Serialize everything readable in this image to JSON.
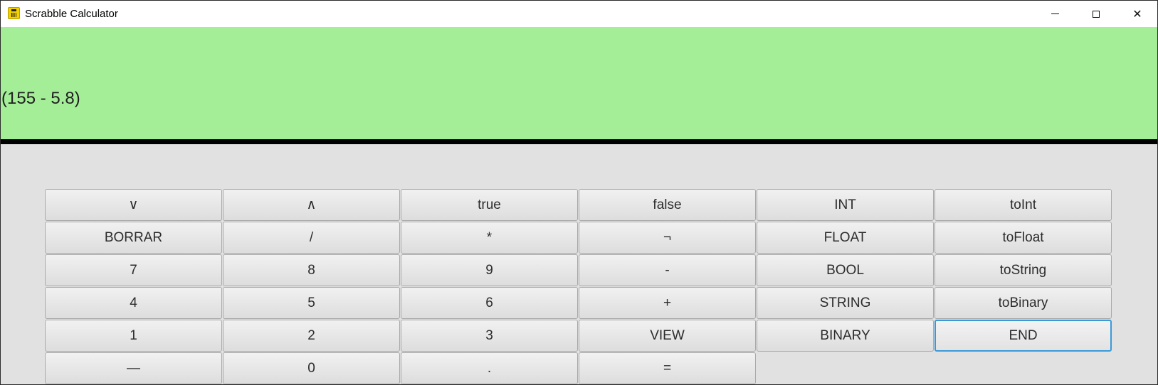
{
  "window": {
    "title": "Scrabble Calculator",
    "icon": "calculator-icon",
    "controls": {
      "minimize": "─",
      "maximize": "☐",
      "close": "✕"
    }
  },
  "display": {
    "expression": "(155 - 5.8)",
    "background": "#a5ee98"
  },
  "keypad": {
    "rows": [
      [
        "∨",
        "∧",
        "true",
        "false",
        "INT",
        "toInt"
      ],
      [
        "BORRAR",
        "/",
        "*",
        "¬",
        "FLOAT",
        "toFloat"
      ],
      [
        "7",
        "8",
        "9",
        "-",
        "BOOL",
        "toString"
      ],
      [
        "4",
        "5",
        "6",
        "+",
        "STRING",
        "toBinary"
      ],
      [
        "1",
        "2",
        "3",
        "VIEW",
        "BINARY",
        "END"
      ],
      [
        "—",
        "0",
        ".",
        "="
      ]
    ],
    "focused_key": "END",
    "focus_color": "#3a9ad9"
  }
}
